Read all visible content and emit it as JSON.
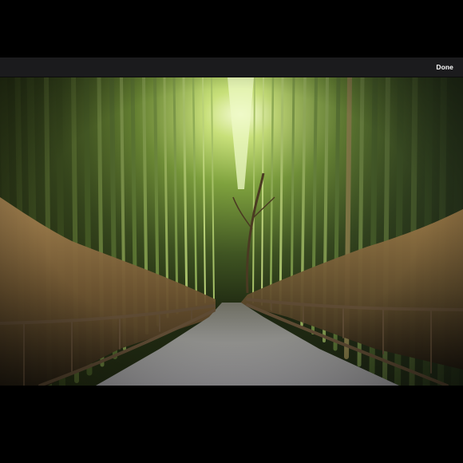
{
  "toolbar": {
    "done_label": "Done"
  },
  "photo": {
    "subject": "bamboo-forest-path",
    "colors": {
      "sky_glow": "#e9f7b8",
      "bamboo_light": "#a9c85a",
      "bamboo_mid": "#6f8f3a",
      "bamboo_dark": "#33421c",
      "grass": "#8a6a3c",
      "path": "#8d8d8f",
      "fence": "#5d4a33"
    }
  }
}
